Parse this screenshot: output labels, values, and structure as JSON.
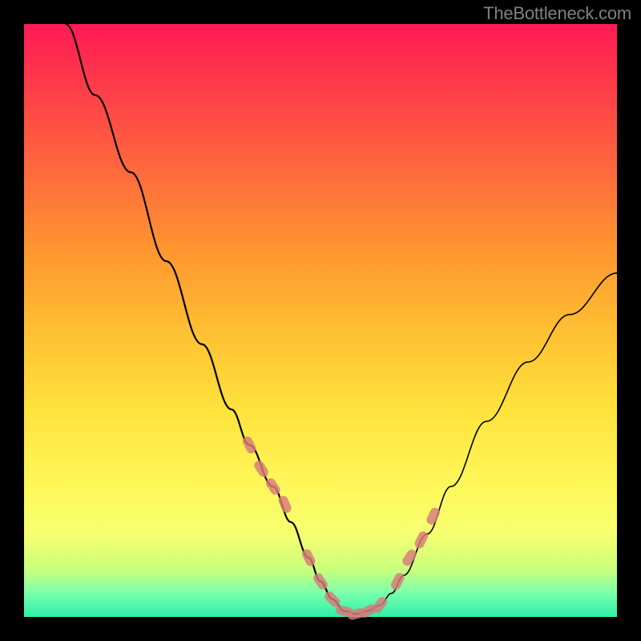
{
  "watermark": "TheBottleneck.com",
  "chart_data": {
    "type": "line",
    "title": "",
    "xlabel": "",
    "ylabel": "",
    "xlim": [
      0,
      100
    ],
    "ylim": [
      0,
      100
    ],
    "grid": false,
    "background_gradient": [
      "#ff1a54",
      "#ffe23c",
      "#2bf0a8"
    ],
    "series": [
      {
        "name": "curve",
        "x": [
          7,
          12,
          18,
          24,
          30,
          35,
          38,
          42,
          45,
          48,
          50,
          52,
          54,
          56,
          58,
          60,
          62,
          64,
          68,
          72,
          78,
          85,
          92,
          100
        ],
        "y": [
          100,
          88,
          75,
          60,
          46,
          35,
          29,
          22,
          16,
          10,
          6,
          3,
          1,
          0.5,
          1,
          2,
          4,
          7,
          14,
          22,
          33,
          43,
          51,
          58
        ]
      }
    ],
    "markers": {
      "name": "highlighted-points",
      "color": "#d87a7a",
      "x": [
        38,
        40,
        42,
        44,
        48,
        50,
        52,
        54,
        56,
        58,
        60,
        63,
        65,
        67,
        69
      ],
      "y": [
        29,
        25,
        22,
        19,
        10,
        6,
        3,
        1,
        0.5,
        1,
        2,
        6,
        10,
        13,
        17
      ]
    }
  }
}
